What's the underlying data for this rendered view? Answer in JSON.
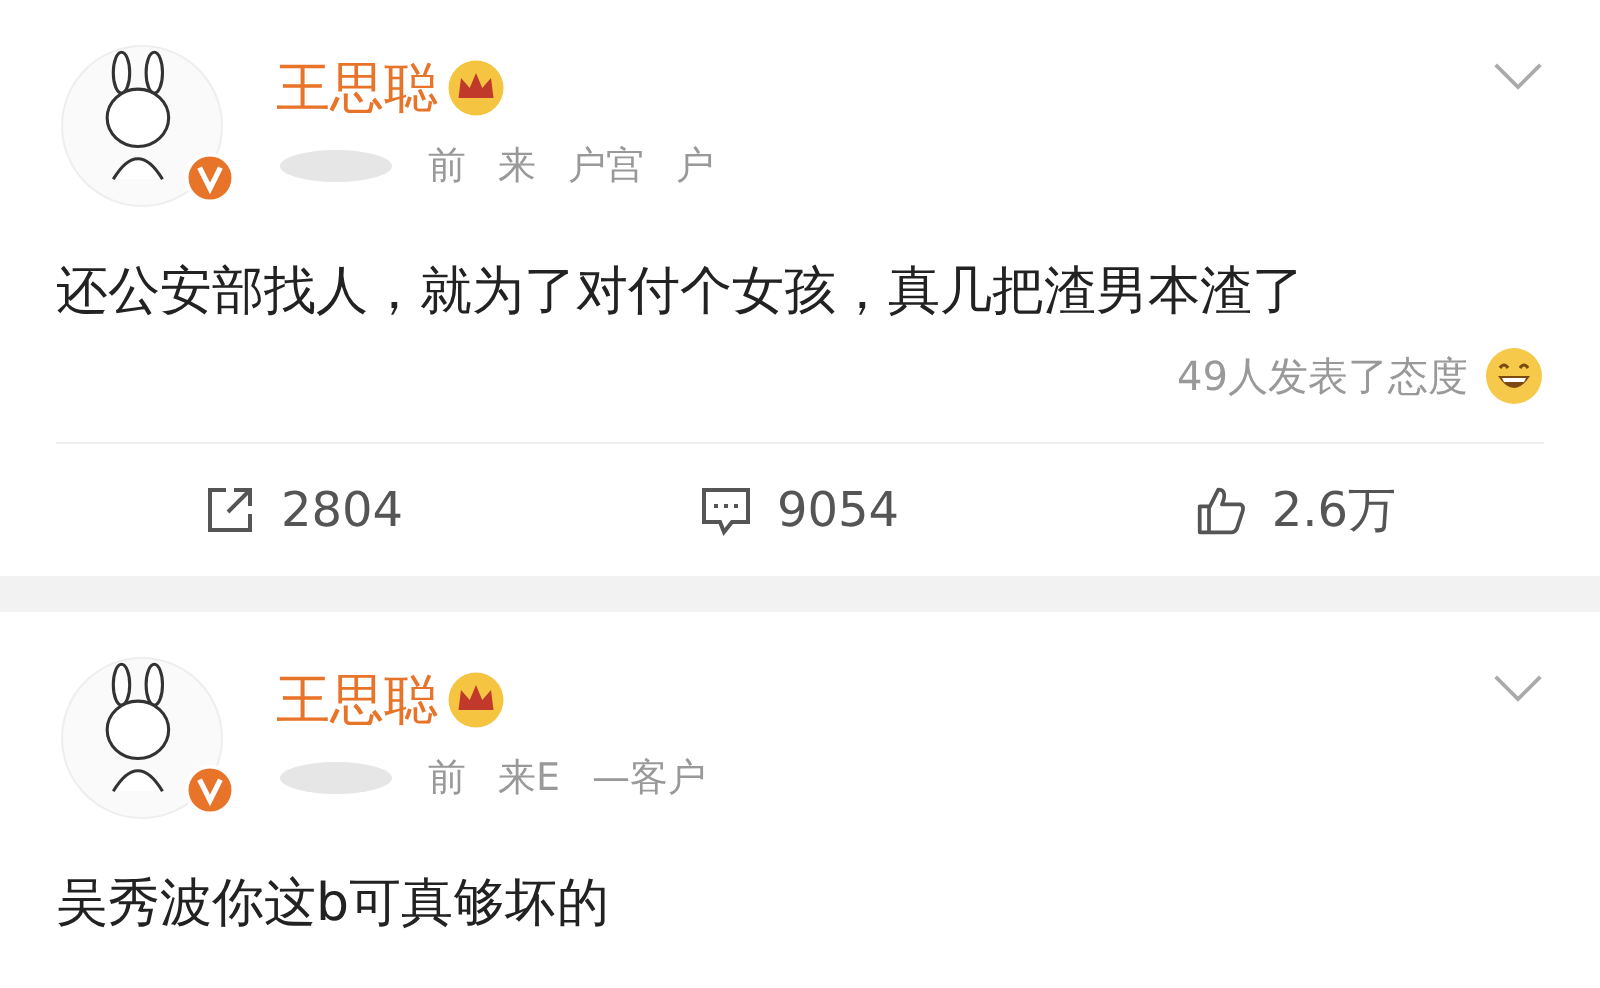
{
  "posts": [
    {
      "author": "王思聪",
      "meta": [
        "前",
        "来",
        "户宫",
        "户"
      ],
      "text": "还公安部找人，就为了对付个女孩，真几把渣男本渣了",
      "reactions": "49人发表了态度",
      "actions": [
        {
          "kind": "repost",
          "label": "2804"
        },
        {
          "kind": "comment",
          "label": "9054"
        },
        {
          "kind": "like",
          "label": "2.6万"
        }
      ]
    },
    {
      "author": "王思聪",
      "meta": [
        "前",
        "来E",
        "—客户"
      ],
      "text": "吴秀波你这b可真够坏的"
    }
  ]
}
